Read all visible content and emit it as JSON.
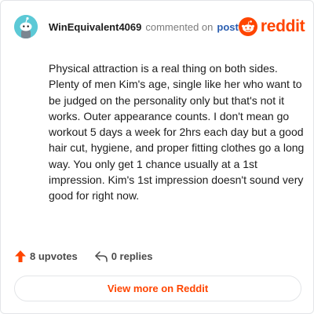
{
  "header": {
    "username": "WinEquivalent4069",
    "action_text": "commented on",
    "post_link": "post",
    "brand_word": "reddit",
    "avatar_icon": "snoo-avatar-icon",
    "brand_icon": "reddit-logo-icon"
  },
  "comment": {
    "text": "Physical attraction is a real thing on both sides. Plenty of men Kim's age, single like her who want to be judged on the personality only but that's not it works. Outer appearance counts. I don't mean go workout 5 days a week for 2hrs each day but a good hair cut, hygiene, and proper fitting clothes go a long way. You only get 1 chance usually at a 1st impression. Kim's 1st impression doesn't sound very good for right now."
  },
  "footer": {
    "upvotes": "8 upvotes",
    "replies": "0 replies",
    "upvote_icon": "upvote-arrow-icon",
    "reply_icon": "reply-arrow-icon",
    "view_more": "View more on Reddit"
  },
  "colors": {
    "brand": "#ff4500",
    "link": "#2a5db0",
    "avatar_bg": "#5cc9d6",
    "text": "#1c1c1c",
    "muted": "#7c7c7c"
  }
}
